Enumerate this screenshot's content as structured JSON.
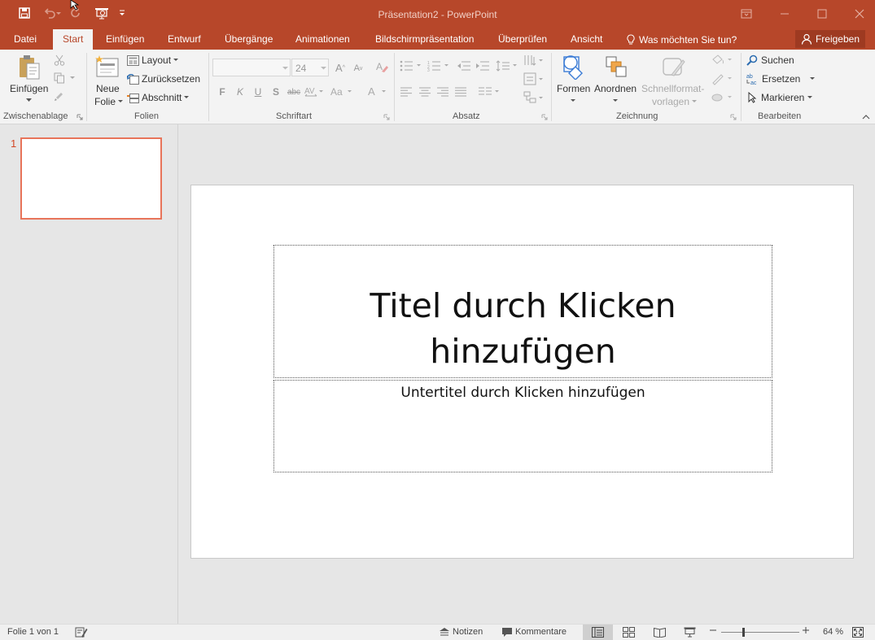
{
  "window": {
    "title": "Präsentation2 - PowerPoint"
  },
  "tabs": {
    "datei": "Datei",
    "start": "Start",
    "einfuegen": "Einfügen",
    "entwurf": "Entwurf",
    "uebergaenge": "Übergänge",
    "animationen": "Animationen",
    "bildschirm": "Bildschirmpräsentation",
    "ueberpruefen": "Überprüfen",
    "ansicht": "Ansicht",
    "tell_me": "Was möchten Sie tun?",
    "share": "Freigeben"
  },
  "ribbon": {
    "clipboard": {
      "paste": "Einfügen",
      "label": "Zwischenablage"
    },
    "slides": {
      "new_slide_line1": "Neue",
      "new_slide_line2": "Folie",
      "layout": "Layout",
      "reset": "Zurücksetzen",
      "section": "Abschnitt",
      "label": "Folien"
    },
    "font": {
      "font_name": "",
      "font_size": "24",
      "bold": "F",
      "italic": "K",
      "underline": "U",
      "shadow": "S",
      "strike": "abc",
      "label": "Schriftart"
    },
    "paragraph": {
      "label": "Absatz"
    },
    "drawing": {
      "shapes": "Formen",
      "arrange": "Anordnen",
      "quick_styles_line1": "Schnellformat-",
      "quick_styles_line2": "vorlagen",
      "label": "Zeichnung"
    },
    "editing": {
      "find": "Suchen",
      "replace": "Ersetzen",
      "select": "Markieren",
      "label": "Bearbeiten"
    }
  },
  "thumbnails": {
    "slide_number": "1"
  },
  "slide": {
    "title_line1": "Titel durch Klicken",
    "title_line2": "hinzufügen",
    "subtitle": "Untertitel durch Klicken hinzufügen"
  },
  "status": {
    "slide_info": "Folie 1 von 1",
    "notes": "Notizen",
    "comments": "Kommentare",
    "zoom": "64 %"
  },
  "colors": {
    "accent": "#b7472a",
    "selection": "#e8745a"
  }
}
